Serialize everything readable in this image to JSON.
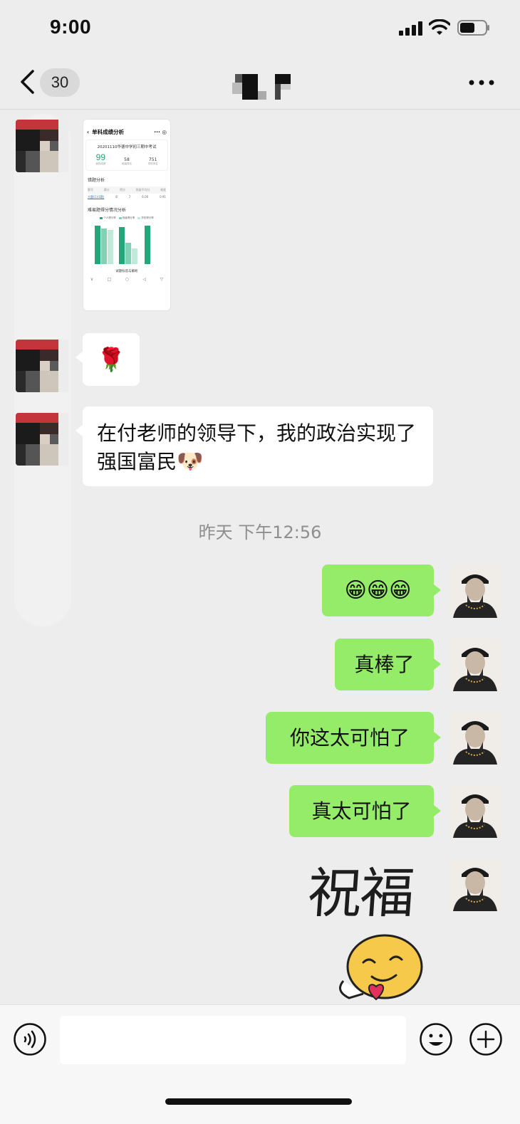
{
  "status_bar": {
    "time": "9:00"
  },
  "nav": {
    "unread_count": "30"
  },
  "messages": {
    "rose_emoji": "🌹",
    "politics_text": "在付老师的领导下，我的政治实现了强国富民",
    "doge_emoji": "🐶",
    "grins": "😁😁😁",
    "great": "真棒了",
    "scary1": "你这太可怕了",
    "scary2": "真太可怕了"
  },
  "timestamp": "昨天 下午12:56",
  "sticker": {
    "text": "祝福"
  },
  "thumbnail": {
    "title": "单科成绩分析",
    "exam": "20201110华德中学初三期中考试",
    "score": "99",
    "score_label": "我的成绩",
    "class_rank": "58",
    "class_rank_label": "班级排名",
    "school_rank": "751",
    "school_rank_label": "学校排名",
    "wrong_section": "错题分析",
    "table_headers": [
      "题号",
      "满分",
      "得分",
      "班级平均分",
      "难度"
    ],
    "table_row": [
      "大题(1)(1题)",
      "8",
      "7",
      "6.00",
      "0.91"
    ],
    "chart_section": "难易题得分情况分析",
    "legend": [
      "个人得分率",
      "班级得分率",
      "学校得分率"
    ],
    "footer": "试题标答与解析"
  },
  "colors": {
    "chat_bg": "#ededed",
    "my_bubble": "#95ec69",
    "their_bubble": "#ffffff",
    "accent_green": "#21a77a"
  },
  "icons": {
    "back": "chevron-left-icon",
    "more": "more-dots-icon",
    "voice": "voice-icon",
    "emoji": "smile-icon",
    "plus": "plus-icon"
  }
}
